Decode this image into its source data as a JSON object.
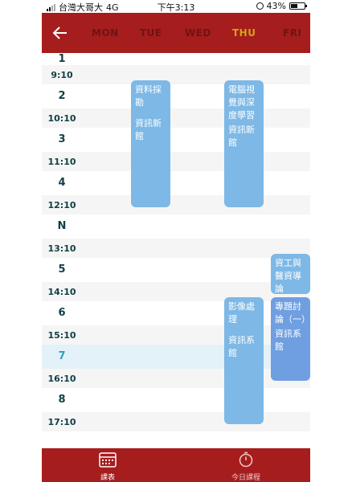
{
  "status_bar": {
    "carrier": "台灣大哥大",
    "network": "4G",
    "time": "下午3:13",
    "battery": "43%"
  },
  "header": {
    "back_icon": "arrow-left-icon",
    "days": [
      "MON",
      "TUE",
      "WED",
      "THU",
      "FRI"
    ],
    "active_day": "THU",
    "colors": {
      "bar": "#a61d1d",
      "day": "#6e1414",
      "active": "#d4a21a"
    }
  },
  "timetable": {
    "rows": [
      {
        "label": "1",
        "type": "period"
      },
      {
        "label": "9:10",
        "type": "time"
      },
      {
        "label": "2",
        "type": "period"
      },
      {
        "label": "10:10",
        "type": "time"
      },
      {
        "label": "3",
        "type": "period"
      },
      {
        "label": "11:10",
        "type": "time"
      },
      {
        "label": "4",
        "type": "period"
      },
      {
        "label": "12:10",
        "type": "time"
      },
      {
        "label": "N",
        "type": "period"
      },
      {
        "label": "13:10",
        "type": "time"
      },
      {
        "label": "5",
        "type": "period"
      },
      {
        "label": "14:10",
        "type": "time"
      },
      {
        "label": "6",
        "type": "period"
      },
      {
        "label": "15:10",
        "type": "time"
      },
      {
        "label": "7",
        "type": "period",
        "highlight": true
      },
      {
        "label": "16:10",
        "type": "time"
      },
      {
        "label": "8",
        "type": "period"
      },
      {
        "label": "17:10",
        "type": "time"
      }
    ],
    "classes": [
      {
        "name": "資料採勘",
        "location": "資訊新館",
        "day": "TUE"
      },
      {
        "name": "電腦視覺與深度學習",
        "location": "資訊新館",
        "day": "THU"
      },
      {
        "name": "影像處理",
        "location": "資訊系館",
        "day": "THU"
      },
      {
        "name": "資工與醫資導論",
        "location": "",
        "day": "FRI"
      },
      {
        "name": "專題討論（一）",
        "location": "資訊系館",
        "day": "FRI"
      }
    ],
    "colors": {
      "class_blue": "#7db8e6",
      "class_blue_dark": "#6f9fe0",
      "label": "#0f3f46",
      "highlight_label": "#2aa3b8"
    }
  },
  "tab_bar": {
    "tabs": [
      {
        "label": "課表",
        "icon": "calendar-icon"
      },
      {
        "label": "今日課程",
        "icon": "timer-icon"
      }
    ]
  }
}
